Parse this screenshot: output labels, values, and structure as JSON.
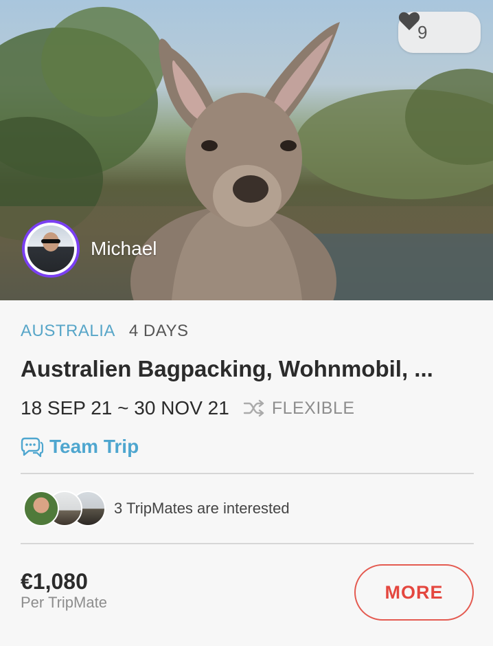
{
  "host": {
    "name": "Michael",
    "avatar_icon": "user-avatar"
  },
  "likes": {
    "count": "9",
    "icon": "heart-icon"
  },
  "trip": {
    "country": "AUSTRALIA",
    "duration": "4 DAYS",
    "title": "Australien Bagpacking, Wohnmobil, ...",
    "date_range": "18 SEP 21 ~ 30 NOV 21",
    "flexible_label": "FLEXIBLE",
    "type_label": "Team Trip"
  },
  "tripmates": {
    "text": "3 TripMates are interested",
    "count": 3
  },
  "pricing": {
    "price": "€1,080",
    "per_label": "Per TripMate"
  },
  "actions": {
    "more_label": "MORE"
  },
  "colors": {
    "accent_blue": "#58a6c8",
    "button_red": "#e4473f",
    "avatar_ring": "#7a3ff2",
    "text_dark": "#2b2b2b",
    "text_muted": "#8d8d8d"
  }
}
